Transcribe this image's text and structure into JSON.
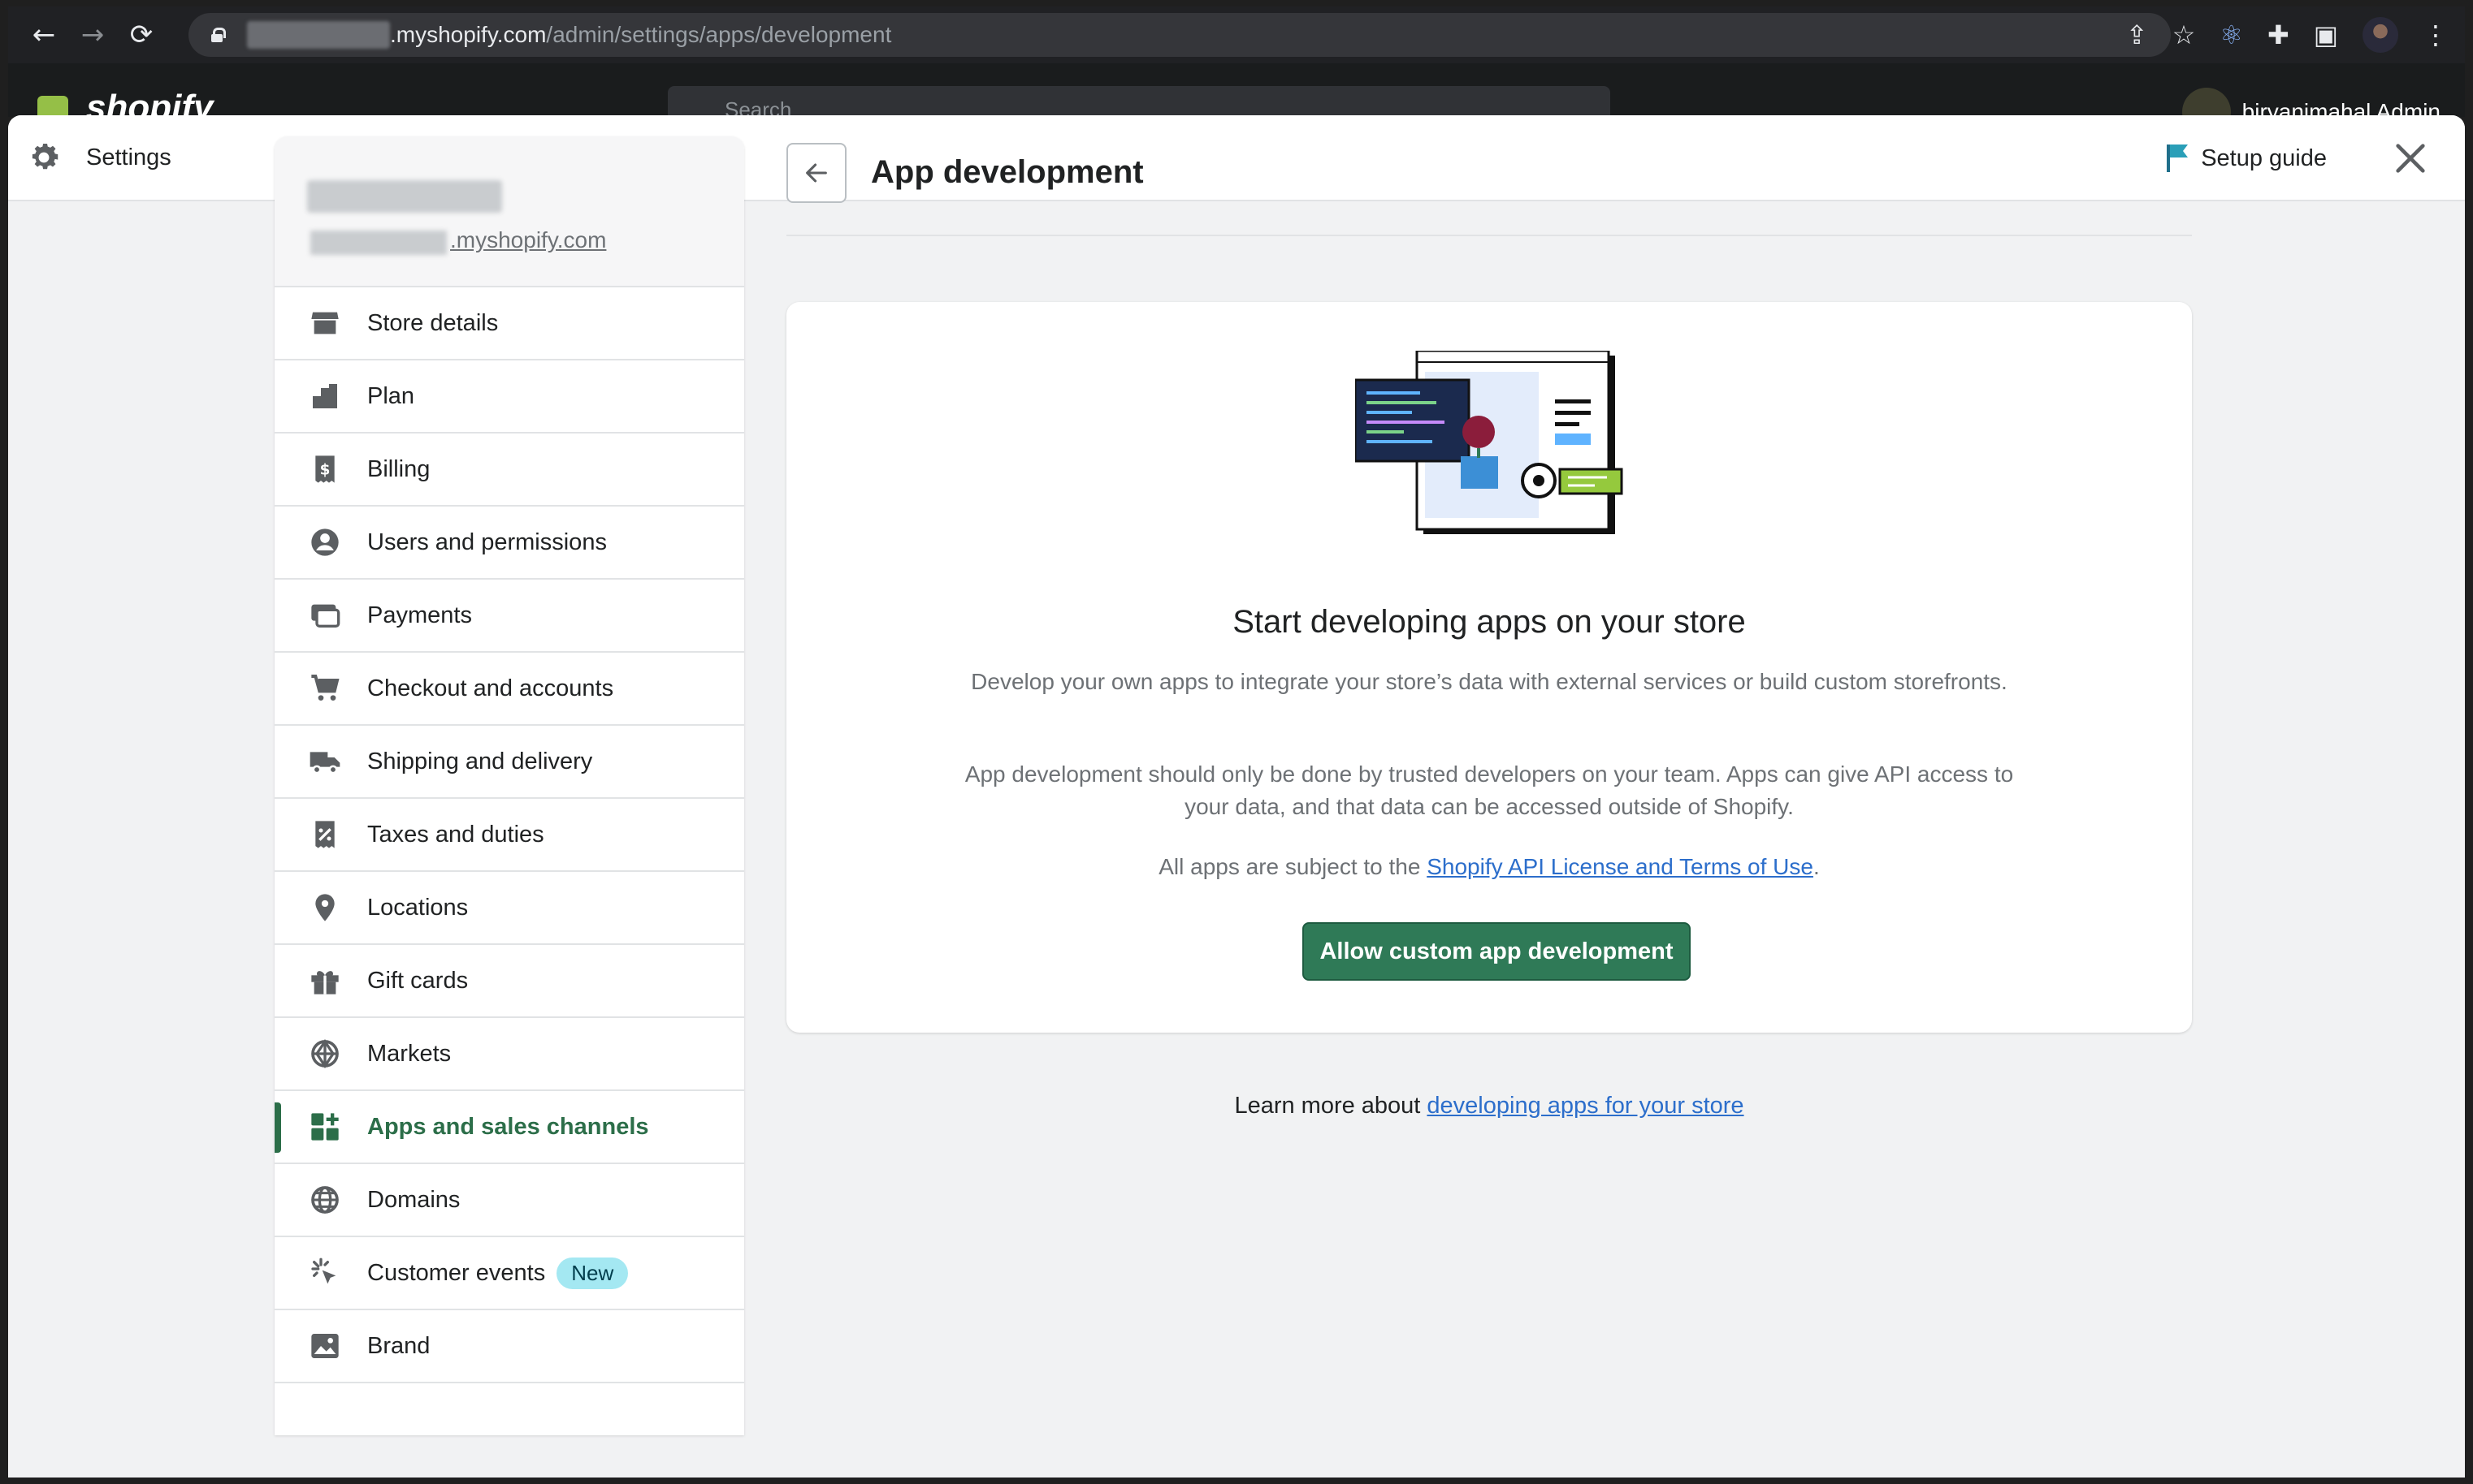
{
  "browser": {
    "url_host": ".myshopify.com",
    "url_path": "/admin/settings/apps/development"
  },
  "admin": {
    "logo": "shopify",
    "search_placeholder": "Search",
    "user_name": "biryanimahal Admin"
  },
  "header": {
    "title": "Settings",
    "setup_guide": "Setup guide"
  },
  "sidebar": {
    "store_domain": ".myshopify.com",
    "items": [
      {
        "label": "Store details",
        "icon": "store-icon"
      },
      {
        "label": "Plan",
        "icon": "plan-icon"
      },
      {
        "label": "Billing",
        "icon": "billing-icon"
      },
      {
        "label": "Users and permissions",
        "icon": "user-icon"
      },
      {
        "label": "Payments",
        "icon": "payments-icon"
      },
      {
        "label": "Checkout and accounts",
        "icon": "cart-icon"
      },
      {
        "label": "Shipping and delivery",
        "icon": "truck-icon"
      },
      {
        "label": "Taxes and duties",
        "icon": "tax-icon"
      },
      {
        "label": "Locations",
        "icon": "location-icon"
      },
      {
        "label": "Gift cards",
        "icon": "gift-icon"
      },
      {
        "label": "Markets",
        "icon": "globe-icon"
      },
      {
        "label": "Apps and sales channels",
        "icon": "apps-icon",
        "active": true
      },
      {
        "label": "Domains",
        "icon": "domains-icon"
      },
      {
        "label": "Customer events",
        "icon": "cursor-icon",
        "badge": "New"
      },
      {
        "label": "Brand",
        "icon": "brand-icon"
      }
    ]
  },
  "main": {
    "title": "App development",
    "card": {
      "heading": "Start developing apps on your store",
      "p1": "Develop your own apps to integrate your store’s data with external services or build custom storefronts.",
      "p2": "App development should only be done by trusted developers on your team. Apps can give API access to your data, and that data can be accessed outside of Shopify.",
      "p3_prefix": "All apps are subject to the ",
      "p3_link": "Shopify API License and Terms of Use",
      "p3_suffix": ".",
      "button": "Allow custom app development"
    },
    "learn_prefix": "Learn more about ",
    "learn_link": "developing apps for your store"
  },
  "colors": {
    "primary": "#2f7a57",
    "active_nav": "#2c6e49",
    "link": "#2c6ecb",
    "badge": "#a4e8f2"
  }
}
